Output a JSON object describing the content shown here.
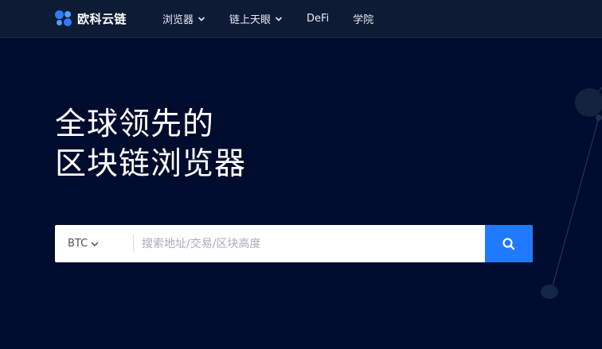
{
  "brand": {
    "name": "欧科云链"
  },
  "nav": {
    "items": [
      {
        "label": "浏览器",
        "has_dropdown": true
      },
      {
        "label": "链上天眼",
        "has_dropdown": true
      },
      {
        "label": "DeFi",
        "has_dropdown": false
      },
      {
        "label": "学院",
        "has_dropdown": false
      }
    ]
  },
  "hero": {
    "title_line1": "全球领先的",
    "title_line2": "区块链浏览器"
  },
  "search": {
    "coin": "BTC",
    "placeholder": "搜索地址/交易/区块高度",
    "button_icon": "search-icon"
  },
  "colors": {
    "background": "#000c2d",
    "navbar": "#0d1b35",
    "accent": "#1f7aff"
  }
}
